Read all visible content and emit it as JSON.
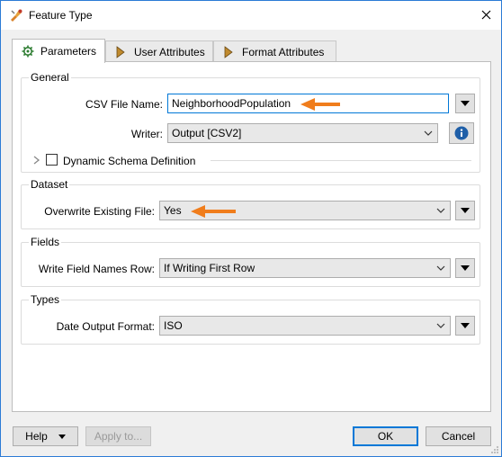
{
  "window": {
    "title": "Feature Type",
    "close_glyph": "✕"
  },
  "tabs": [
    {
      "label": "Parameters",
      "icon": "gear-icon",
      "active": true
    },
    {
      "label": "User Attributes",
      "icon": "arrow-right-icon",
      "active": false
    },
    {
      "label": "Format Attributes",
      "icon": "arrow-right-icon",
      "active": false
    }
  ],
  "general": {
    "title": "General",
    "csv_file_name_label": "CSV File Name:",
    "csv_file_name_value": "NeighborhoodPopulation",
    "writer_label": "Writer:",
    "writer_value": "Output [CSV2]",
    "dynamic_schema_label": "Dynamic Schema Definition"
  },
  "dataset": {
    "title": "Dataset",
    "overwrite_label": "Overwrite Existing File:",
    "overwrite_value": "Yes"
  },
  "fields": {
    "title": "Fields",
    "write_field_names_label": "Write Field Names Row:",
    "write_field_names_value": "If Writing First Row"
  },
  "types": {
    "title": "Types",
    "date_output_label": "Date Output Format:",
    "date_output_value": "ISO"
  },
  "buttons": {
    "help": "Help",
    "apply_to": "Apply to...",
    "ok": "OK",
    "cancel": "Cancel"
  },
  "colors": {
    "annotation_arrow": "#f07d1c",
    "focus_border": "#0078d7",
    "info_icon": "#1f5fa8"
  }
}
